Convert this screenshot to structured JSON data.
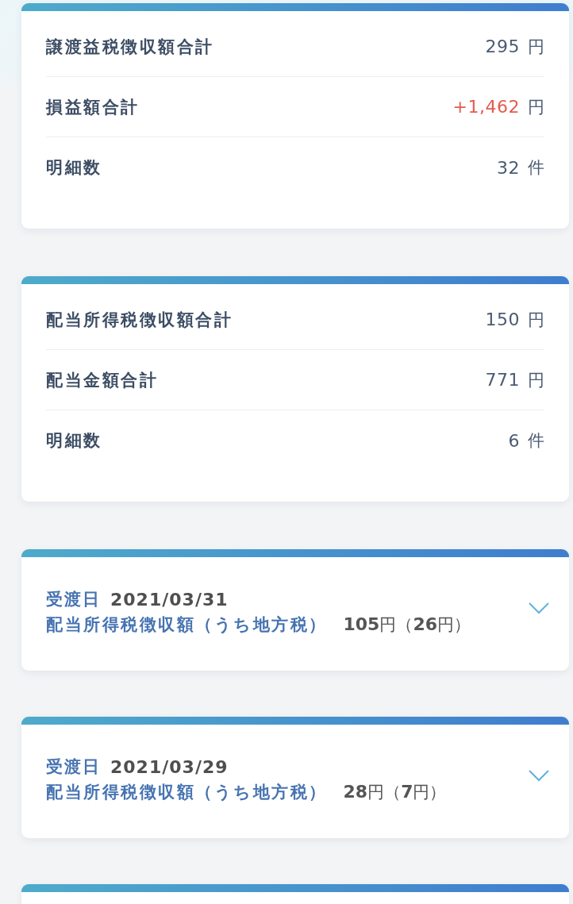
{
  "summary_cards": [
    {
      "rows": [
        {
          "label": "譲渡益税徴収額合計",
          "value": "295",
          "unit": "円",
          "kind": "amount"
        },
        {
          "label": "損益額合計",
          "value": "+1,462",
          "unit": "円",
          "kind": "gain"
        },
        {
          "label": "明細数",
          "value": "32",
          "unit": "件",
          "kind": "amount"
        }
      ]
    },
    {
      "rows": [
        {
          "label": "配当所得税徴収額合計",
          "value": "150",
          "unit": "円",
          "kind": "amount"
        },
        {
          "label": "配当金額合計",
          "value": "771",
          "unit": "円",
          "kind": "amount"
        },
        {
          "label": "明細数",
          "value": "6",
          "unit": "件",
          "kind": "amount"
        }
      ]
    }
  ],
  "detail_cards": [
    {
      "date_label": "受渡日",
      "date": "2021/03/31",
      "tax_label": "配当所得税徴収額（うち地方税）",
      "tax_amount": "**105**円（**26**円）",
      "expanded": false
    },
    {
      "date_label": "受渡日",
      "date": "2021/03/29",
      "tax_label": "配当所得税徴収額（うち地方税）",
      "tax_amount": "**28**円（**7**円）",
      "expanded": false
    }
  ]
}
